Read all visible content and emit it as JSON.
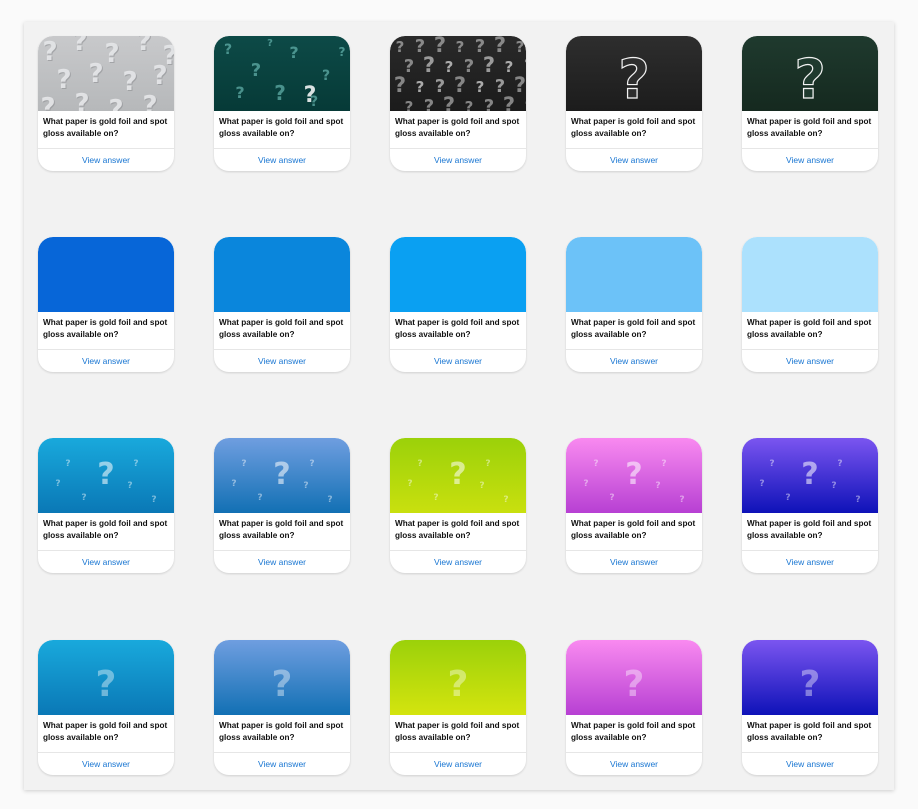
{
  "cards": [
    {
      "question": "What paper is gold foil and spot gloss available on?",
      "answer": "View answer",
      "thumb": "embossed-question-marks",
      "colors": [
        "#c8c9cb",
        "#b6b8ba"
      ]
    },
    {
      "question": "What paper is gold foil and spot gloss available on?",
      "answer": "View answer",
      "thumb": "teal-chalk-question-marks",
      "colors": [
        "#0d4a47",
        "#063a37"
      ]
    },
    {
      "question": "What paper is gold foil and spot gloss available on?",
      "answer": "View answer",
      "thumb": "black-chalkboard-question-marks",
      "colors": [
        "#2a2a2a",
        "#1b1b1b"
      ]
    },
    {
      "question": "What paper is gold foil and spot gloss available on?",
      "answer": "View answer",
      "thumb": "chalk-question-mark-dark",
      "colors": [
        "#2e2e2e",
        "#1c1c1c"
      ]
    },
    {
      "question": "What paper is gold foil and spot gloss available on?",
      "answer": "View answer",
      "thumb": "chalk-question-mark-green",
      "colors": [
        "#1f3a2e",
        "#15291f"
      ]
    },
    {
      "question": "What paper is gold foil and spot gloss available on?",
      "answer": "View answer",
      "thumb": "solid",
      "colors": [
        "#0766d8",
        "#0766d8"
      ]
    },
    {
      "question": "What paper is gold foil and spot gloss available on?",
      "answer": "View answer",
      "thumb": "solid",
      "colors": [
        "#0a86dc",
        "#0a86dc"
      ]
    },
    {
      "question": "What paper is gold foil and spot gloss available on?",
      "answer": "View answer",
      "thumb": "solid",
      "colors": [
        "#0aa0f2",
        "#0aa0f2"
      ]
    },
    {
      "question": "What paper is gold foil and spot gloss available on?",
      "answer": "View answer",
      "thumb": "solid",
      "colors": [
        "#6cc2f8",
        "#6cc2f8"
      ]
    },
    {
      "question": "What paper is gold foil and spot gloss available on?",
      "answer": "View answer",
      "thumb": "solid",
      "colors": [
        "#ace1fd",
        "#ace1fd"
      ]
    },
    {
      "question": "What paper is gold foil and spot gloss available on?",
      "answer": "View answer",
      "thumb": "scattered-question-marks",
      "colors": [
        "#19a9dc",
        "#0a78b6"
      ]
    },
    {
      "question": "What paper is gold foil and spot gloss available on?",
      "answer": "View answer",
      "thumb": "scattered-question-marks",
      "colors": [
        "#6f9ee0",
        "#1270b4"
      ]
    },
    {
      "question": "What paper is gold foil and spot gloss available on?",
      "answer": "View answer",
      "thumb": "scattered-question-marks",
      "colors": [
        "#9bd10a",
        "#c9e00e"
      ]
    },
    {
      "question": "What paper is gold foil and spot gloss available on?",
      "answer": "View answer",
      "thumb": "scattered-question-marks",
      "colors": [
        "#f98af0",
        "#b740d3"
      ]
    },
    {
      "question": "What paper is gold foil and spot gloss available on?",
      "answer": "View answer",
      "thumb": "scattered-question-marks",
      "colors": [
        "#7b55f0",
        "#0e12b8"
      ]
    },
    {
      "question": "What paper is gold foil and spot gloss available on?",
      "answer": "View answer",
      "thumb": "single-question-mark",
      "colors": [
        "#19a9dc",
        "#0a78b6"
      ]
    },
    {
      "question": "What paper is gold foil and spot gloss available on?",
      "answer": "View answer",
      "thumb": "single-question-mark",
      "colors": [
        "#6f9ee0",
        "#1270b4"
      ]
    },
    {
      "question": "What paper is gold foil and spot gloss available on?",
      "answer": "View answer",
      "thumb": "single-question-mark",
      "colors": [
        "#9bd10a",
        "#d4e40e"
      ]
    },
    {
      "question": "What paper is gold foil and spot gloss available on?",
      "answer": "View answer",
      "thumb": "single-question-mark",
      "colors": [
        "#f98af0",
        "#b740d3"
      ]
    },
    {
      "question": "What paper is gold foil and spot gloss available on?",
      "answer": "View answer",
      "thumb": "single-question-mark",
      "colors": [
        "#7b55f0",
        "#0e12b8"
      ]
    }
  ]
}
